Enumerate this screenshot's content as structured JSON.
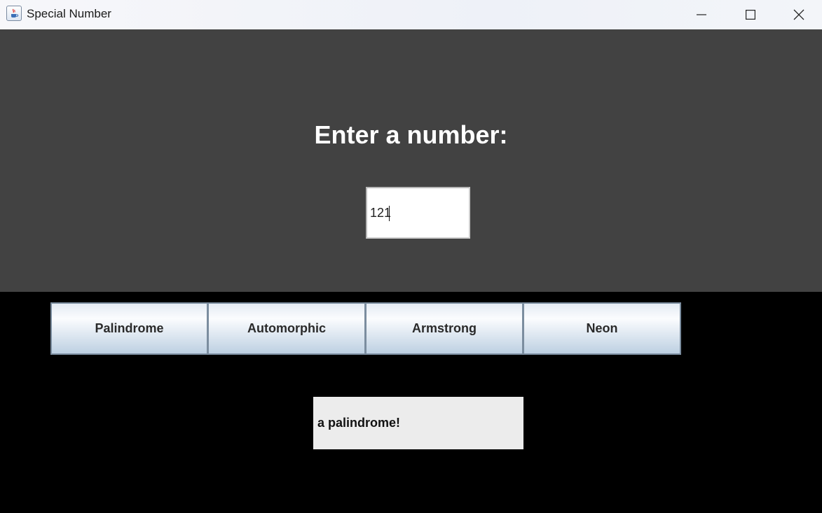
{
  "window": {
    "title": "Special Number",
    "icon": "java-cup-icon",
    "controls": [
      "minimize-icon",
      "maximize-icon",
      "close-icon"
    ]
  },
  "prompt": {
    "heading": "Enter a number:",
    "input_value": "121"
  },
  "buttons": [
    {
      "label": "Palindrome"
    },
    {
      "label": "Automorphic"
    },
    {
      "label": "Armstrong"
    },
    {
      "label": "Neon"
    }
  ],
  "result": {
    "text": "a palindrome!"
  },
  "colors": {
    "top_panel": "#424242",
    "bottom_panel": "#000000",
    "result_bg": "#ececec"
  }
}
